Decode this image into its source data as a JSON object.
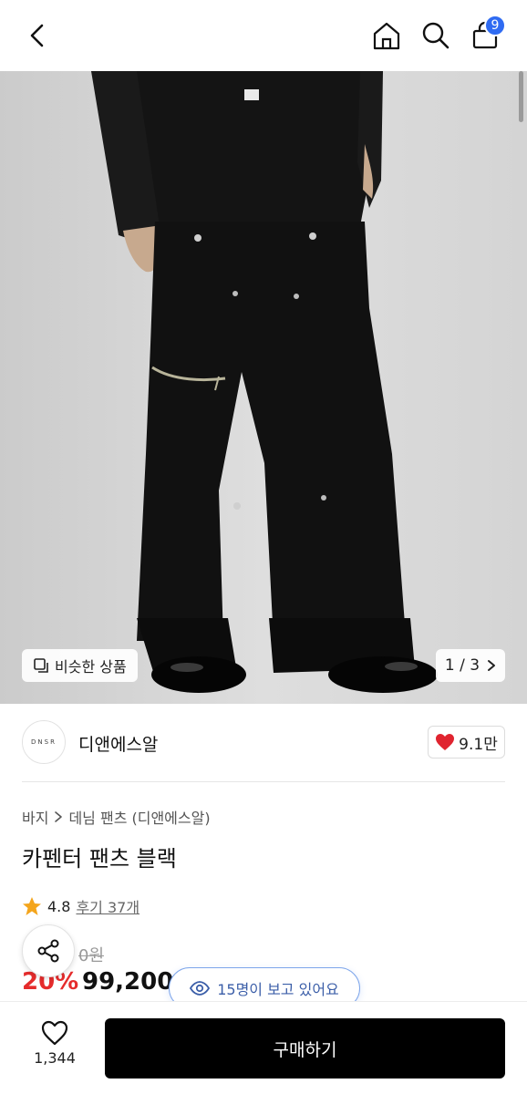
{
  "header": {
    "back_icon": "chevron-left-icon",
    "home_icon": "home-icon",
    "search_icon": "search-icon",
    "cart_icon": "shopping-bag-icon",
    "cart_badge": "9",
    "badge_color": "#2f6bf2"
  },
  "hero": {
    "similar_label": "비슷한 상품",
    "pager_text": "1 / 3"
  },
  "brand": {
    "logo_text": "DNSR",
    "name": "디앤에스알",
    "likes": "9.1만"
  },
  "product": {
    "breadcrumb": [
      "바지",
      "데님 팬츠 (디앤에스알)"
    ],
    "title": "카펜터 팬츠 블랙",
    "rating": "4.8",
    "reviews": "후기 37개",
    "original_price": "0원",
    "discount": "20%",
    "price": "99,200"
  },
  "overlays": {
    "viewers": "15명이 보고 있어요"
  },
  "bottom": {
    "wish_count": "1,344",
    "buy_label": "구매하기"
  },
  "colors": {
    "accent": "#2f6bf2",
    "discount": "#e52c2c",
    "heart": "#e0242f"
  }
}
